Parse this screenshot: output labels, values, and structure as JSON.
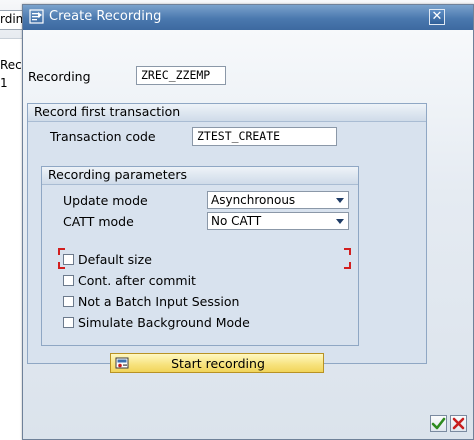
{
  "background": {
    "tab_fragment": "rdin",
    "list_fragment_1": "Recor",
    "list_fragment_2": "1"
  },
  "dialog": {
    "title": "Create Recording",
    "close_glyph": "✕"
  },
  "recording": {
    "label": "Recording",
    "value": "ZREC_ZZEMP"
  },
  "record_first_transaction": {
    "header": "Record first transaction",
    "transaction_code_label": "Transaction code",
    "transaction_code_value": "ZTEST_CREATE"
  },
  "recording_parameters": {
    "header": "Recording parameters",
    "update_mode_label": "Update mode",
    "update_mode_value": "Asynchronous",
    "catt_mode_label": "CATT mode",
    "catt_mode_value": "No CATT",
    "options": [
      {
        "label": "Default size",
        "checked": false
      },
      {
        "label": "Cont. after commit",
        "checked": false
      },
      {
        "label": "Not a Batch Input Session",
        "checked": false
      },
      {
        "label": "Simulate Background Mode",
        "checked": false
      }
    ]
  },
  "actions": {
    "start_recording_label": "Start recording",
    "confirm_icon": "checkmark-icon",
    "cancel_icon": "cross-icon"
  },
  "colors": {
    "title_bar": "#4a78ae",
    "button_yellow": "#f7e27c",
    "confirm_green": "#2e8b1f",
    "cancel_red": "#c81e1e"
  }
}
